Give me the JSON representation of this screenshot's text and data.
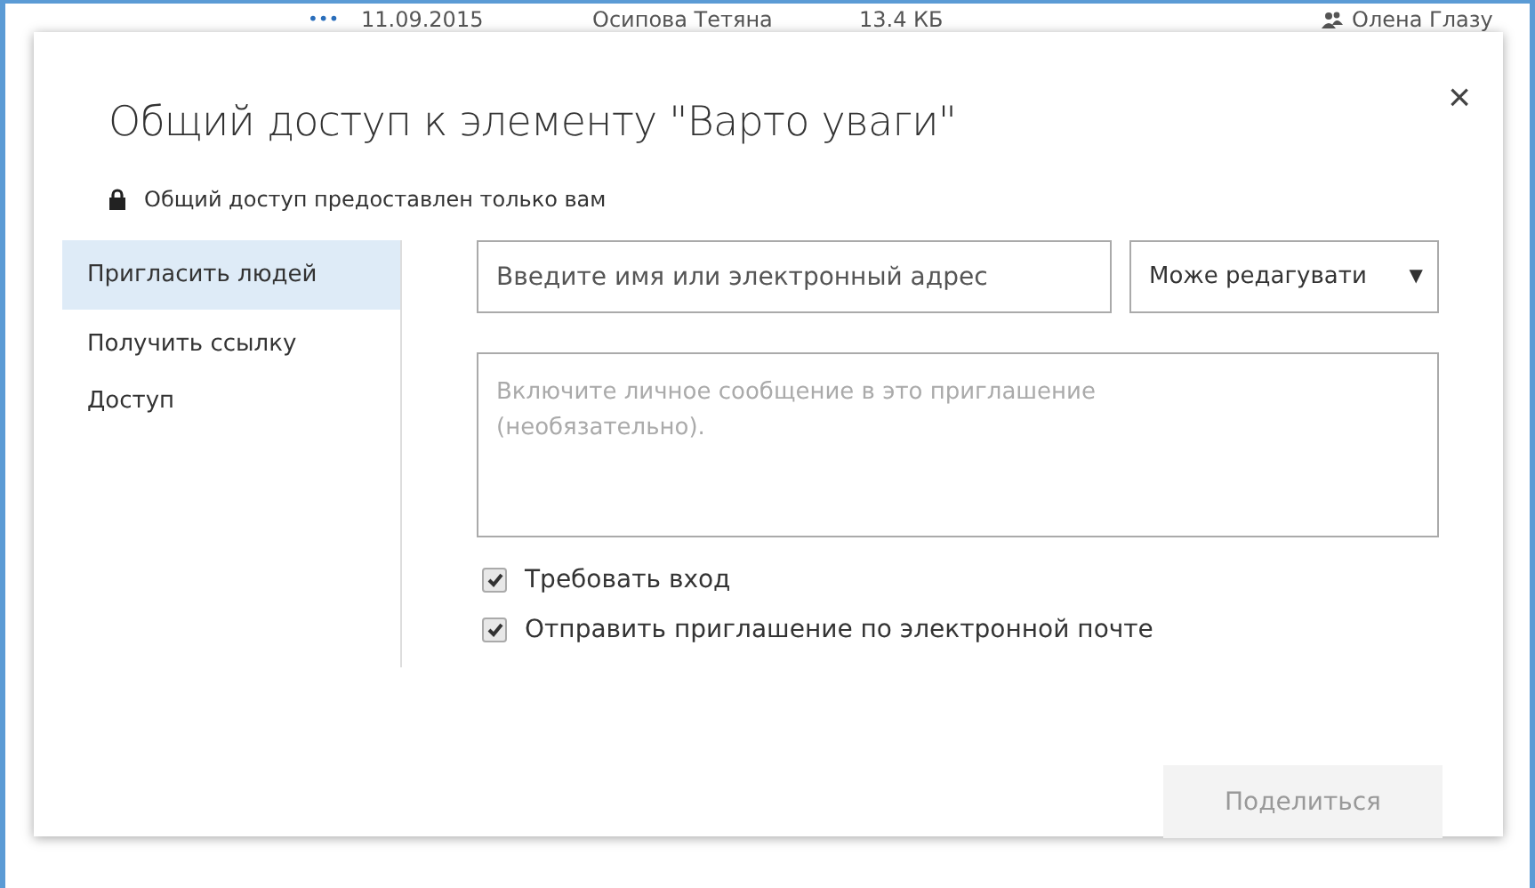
{
  "background_row": {
    "more": "•••",
    "date": "11.09.2015",
    "author": "Осипова Тетяна",
    "size": "13.4 КБ",
    "shared_with": "Олена Глазу"
  },
  "dialog": {
    "title": "Общий доступ к элементу \"Варто уваги\"",
    "close": "×",
    "status": "Общий доступ предоставлен только вам",
    "sidebar": [
      {
        "label": "Пригласить людей",
        "selected": true
      },
      {
        "label": "Получить ссылку",
        "selected": false
      },
      {
        "label": "Доступ",
        "selected": false
      }
    ],
    "name_field": {
      "placeholder": "Введите имя или электронный адрес"
    },
    "permission": {
      "value": "Може редагувати",
      "caret": "▼"
    },
    "message_field": {
      "placeholder": "Включите личное сообщение в это приглашение (необязательно)."
    },
    "options": [
      {
        "label": "Требовать вход",
        "checked": true
      },
      {
        "label": "Отправить приглашение по электронной почте",
        "checked": true
      }
    ],
    "share_button": {
      "label": "Поделиться",
      "disabled": true
    }
  }
}
